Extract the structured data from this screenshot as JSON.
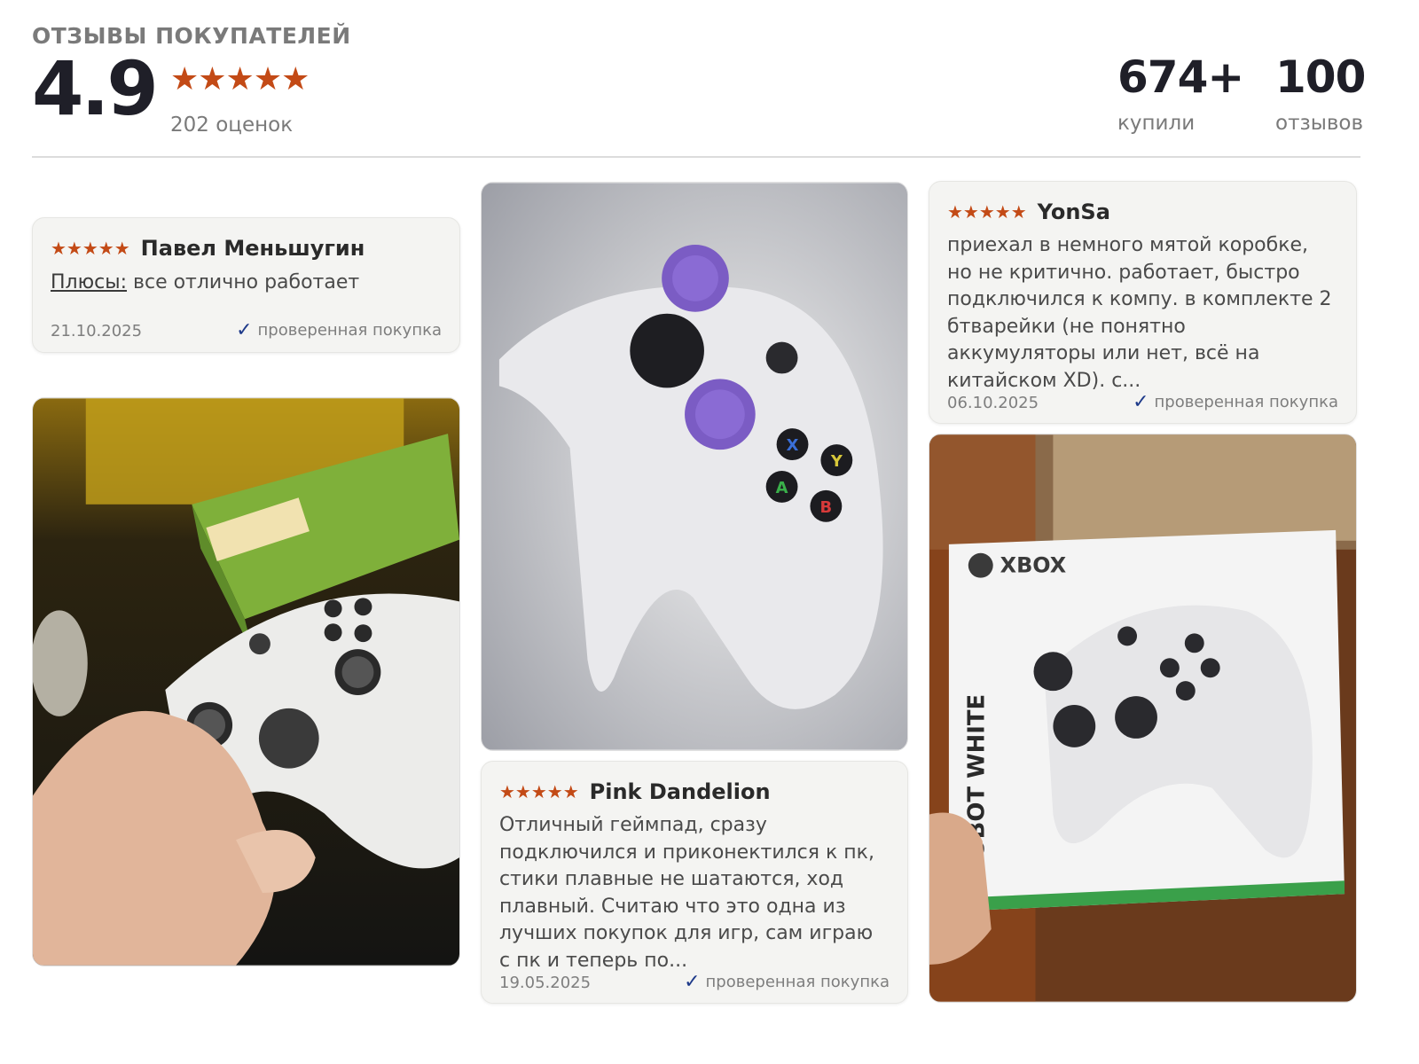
{
  "header": {
    "title": "ОТЗЫВЫ ПОКУПАТЕЛЕЙ",
    "rating": "4.9",
    "stars": "★★★★★",
    "ratings_count": "202 оценок",
    "bought_value": "674+",
    "bought_label": "купили",
    "reviews_value": "100",
    "reviews_label": "отзывов"
  },
  "reviews": [
    {
      "stars": "★★★★★",
      "author": "Павел Меньшугин",
      "pros_label": "Плюсы:",
      "text": " все отлично работает",
      "date": "21.10.2025",
      "verified": "проверенная покупка",
      "check": "✓"
    },
    {
      "stars": "★★★★★",
      "author": "YonSa",
      "text": "приехал в немного мятой коробке, но не критично. работает, быстро подключился к компу. в комплекте 2 бтварейки (не понятно аккумуляторы или нет, всё на китайском XD). с...",
      "date": "06.10.2025",
      "verified": "проверенная покупка",
      "check": "✓"
    },
    {
      "stars": "★★★★★",
      "author": "Pink Dandelion",
      "text": "Отличный геймпад, сразу подключился и приконектился к пк, стики плавные не шатаются, ход плавный. Считаю что это одна из лучших покупок для игр, сам играю с пк и теперь по...",
      "date": "19.05.2025",
      "verified": "проверенная покупка",
      "check": "✓"
    }
  ],
  "photos": {
    "box_brand": "XBOX",
    "box_side": "ROBOT WHITE",
    "button_letters": [
      "X",
      "Y",
      "A",
      "B"
    ]
  },
  "colors": {
    "star": "#c34a16",
    "check": "#1e3a8a",
    "card_bg": "#f4f4f2"
  }
}
